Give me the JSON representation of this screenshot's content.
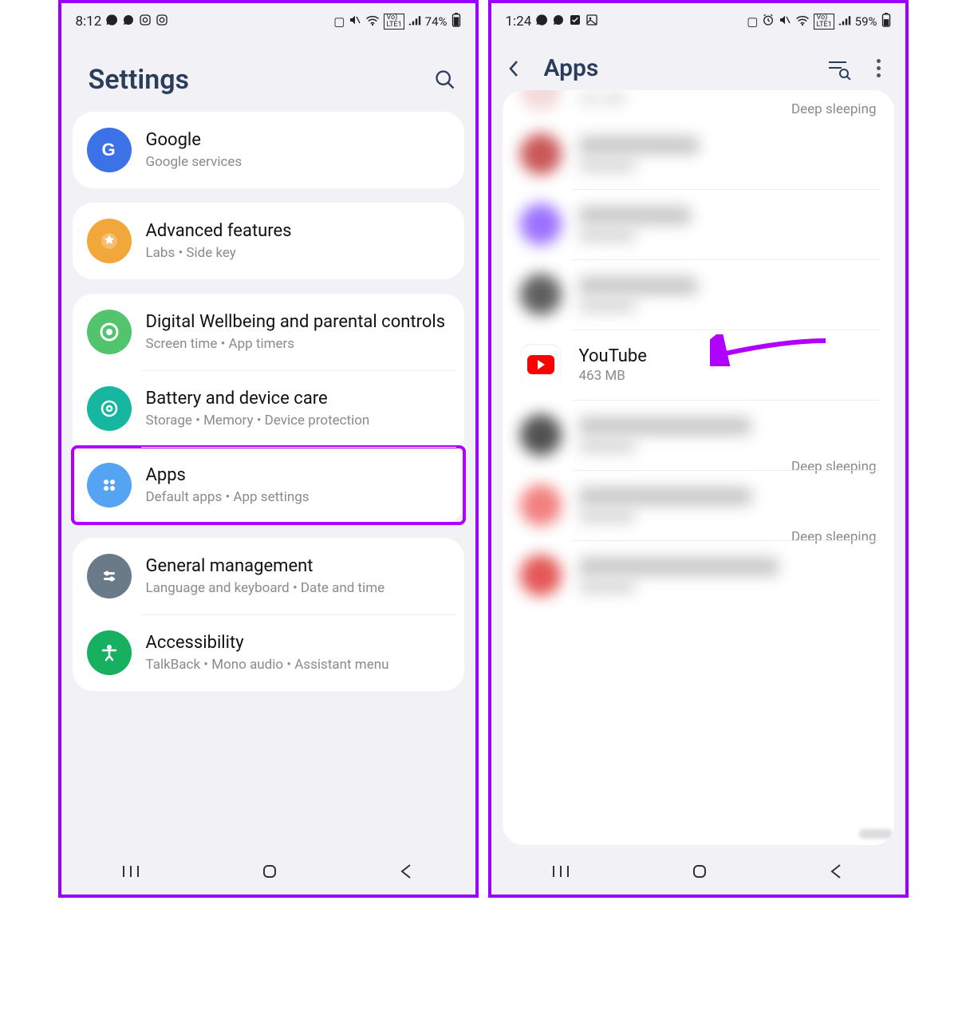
{
  "left": {
    "status": {
      "time": "8:12",
      "battery": "74%"
    },
    "title": "Settings",
    "groups": [
      {
        "items": [
          {
            "icon": "google",
            "color": "#3b72e8",
            "title": "Google",
            "sub": "Google services"
          }
        ]
      },
      {
        "items": [
          {
            "icon": "advanced",
            "color": "#f2a73b",
            "title": "Advanced features",
            "sub": "Labs  •  Side key"
          }
        ]
      },
      {
        "items": [
          {
            "icon": "wellbeing",
            "color": "#51c46d",
            "title": "Digital Wellbeing and parental controls",
            "sub": "Screen time  •  App timers"
          },
          {
            "icon": "battery",
            "color": "#17b6a0",
            "title": "Battery and device care",
            "sub": "Storage  •  Memory  •  Device protection"
          },
          {
            "icon": "apps",
            "color": "#55a3f3",
            "title": "Apps",
            "sub": "Default apps  •  App settings",
            "highlight": true
          }
        ]
      },
      {
        "items": [
          {
            "icon": "general",
            "color": "#6a7a88",
            "title": "General management",
            "sub": "Language and keyboard  •  Date and time"
          },
          {
            "icon": "accessibility",
            "color": "#17b060",
            "title": "Accessibility",
            "sub": "TalkBack  •  Mono audio  •  Assistant menu"
          }
        ]
      }
    ]
  },
  "right": {
    "status": {
      "time": "1:24",
      "battery": "59%"
    },
    "title": "Apps",
    "partial_top_sub": "303 MB",
    "status_label": "Deep sleeping",
    "apps": [
      {
        "name": "",
        "sub": "",
        "blur": true,
        "color": "#c23a3a",
        "status": ""
      },
      {
        "name": "",
        "sub": "",
        "blur": true,
        "color": "#8b59ff",
        "status": ""
      },
      {
        "name": "",
        "sub": "",
        "blur": true,
        "color": "#444",
        "status": ""
      },
      {
        "name": "YouTube",
        "sub": "463 MB",
        "blur": false,
        "color": "#fff",
        "status": "",
        "youtube": true,
        "arrow": true
      },
      {
        "name": "",
        "sub": "",
        "blur": true,
        "color": "#333",
        "status": "Deep sleeping"
      },
      {
        "name": "",
        "sub": "",
        "blur": true,
        "color": "#f06a6a",
        "status": "Deep sleeping"
      },
      {
        "name": "",
        "sub": "",
        "blur": true,
        "color": "#e03a3a",
        "status": ""
      }
    ]
  }
}
